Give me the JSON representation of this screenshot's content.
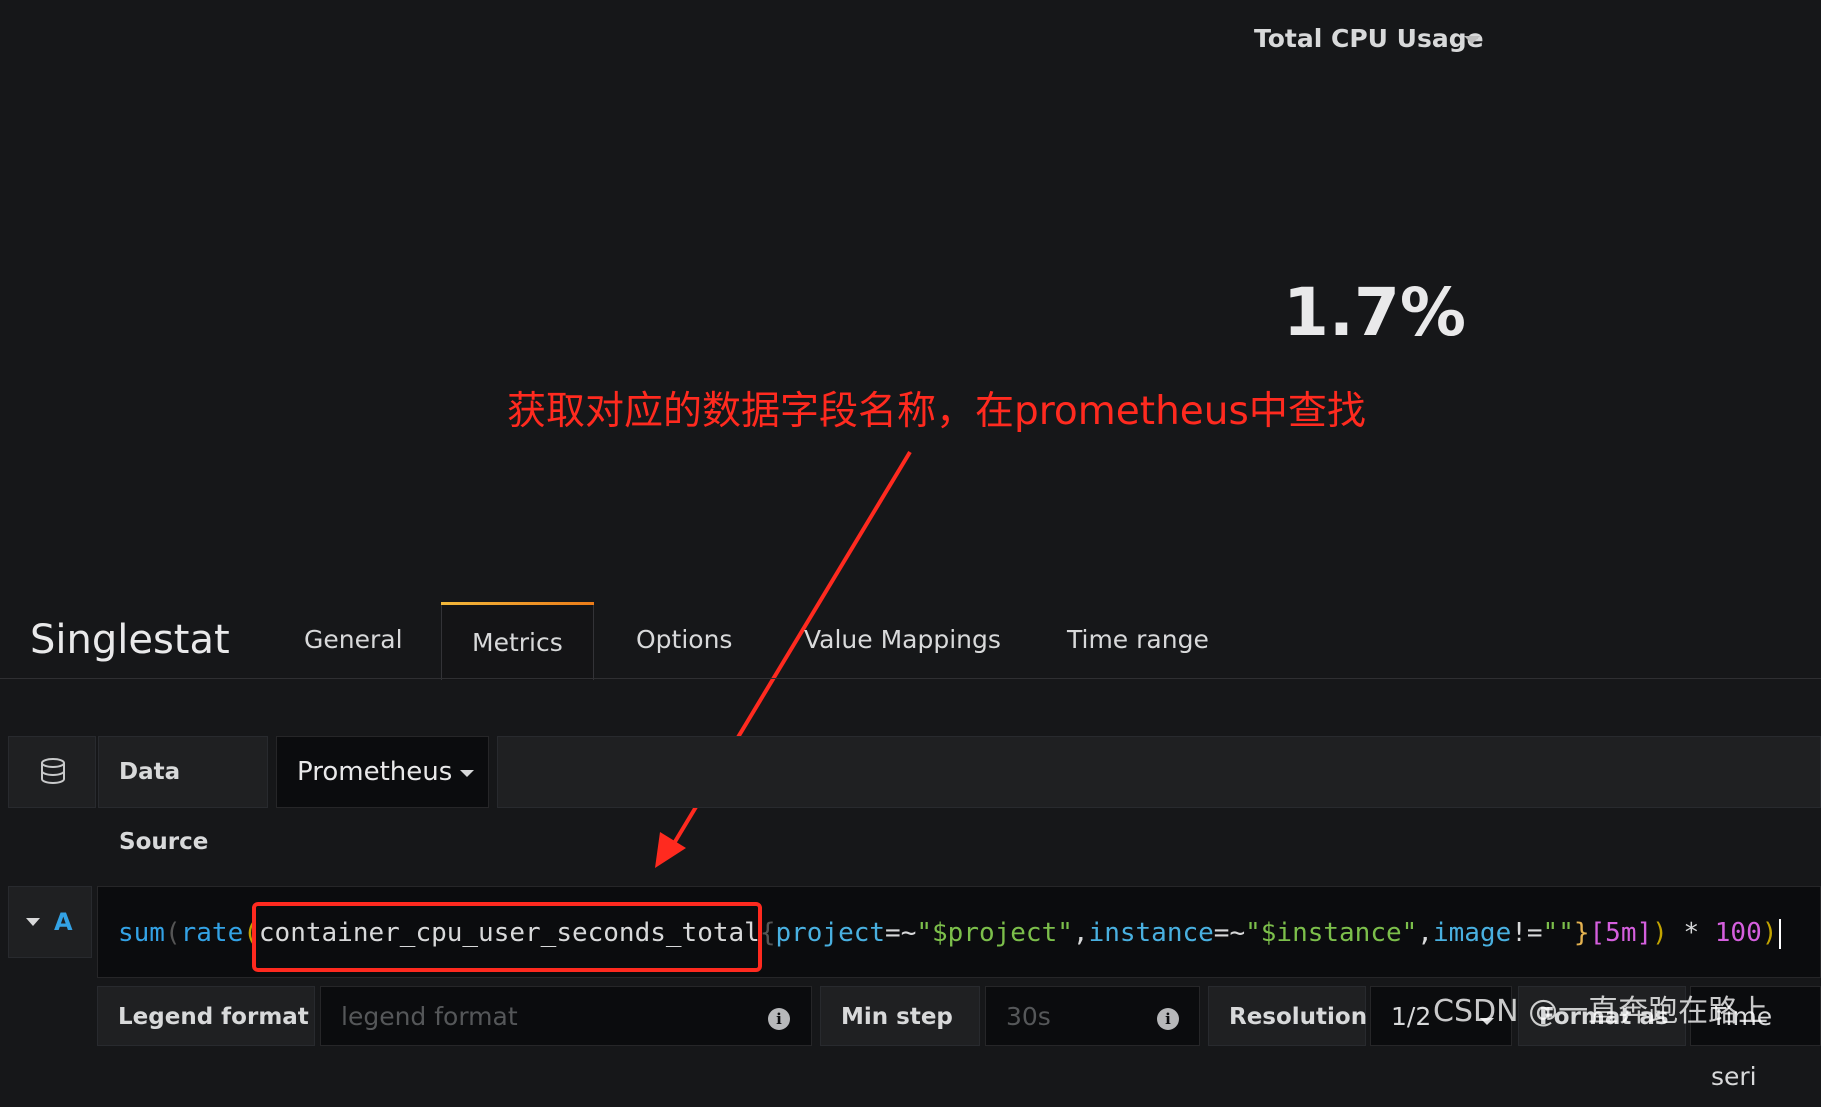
{
  "panel": {
    "title": "Total CPU Usage",
    "stat_value": "1.7%"
  },
  "annotation": {
    "text": "获取对应的数据字段名称，在prometheus中查找"
  },
  "editor": {
    "title": "Singlestat",
    "tabs": [
      {
        "label": "General"
      },
      {
        "label": "Metrics",
        "active": true
      },
      {
        "label": "Options"
      },
      {
        "label": "Value Mappings"
      },
      {
        "label": "Time range"
      }
    ]
  },
  "datasource": {
    "label": "Data Source",
    "value": "Prometheus"
  },
  "query": {
    "ref_id": "A",
    "tokens": {
      "sum": "sum",
      "open1": "(",
      "rate": "rate",
      "open2": "(",
      "metric": "container_cpu_user_seconds_total",
      "lbrace": "{",
      "k1": "project",
      "op1": "=~",
      "v1": "\"$project\"",
      "comma1": ",",
      "k2": "instance",
      "op2": "=~",
      "v2": "\"$instance\"",
      "comma2": ",",
      "k3": "image",
      "op3": "!=",
      "v3": "\"\"",
      "rbrace": "}",
      "range": "[5m]",
      "close2": ")",
      "mult": " * ",
      "num": "100",
      "close1": ")"
    }
  },
  "options": {
    "legend_label": "Legend format",
    "legend_placeholder": "legend format",
    "minstep_label": "Min step",
    "minstep_placeholder": "30s",
    "resolution_label": "Resolution",
    "resolution_value": "1/2",
    "format_label": "Format as",
    "format_value": "Time seri"
  },
  "watermark": "CSDN @一直奔跑在路上"
}
